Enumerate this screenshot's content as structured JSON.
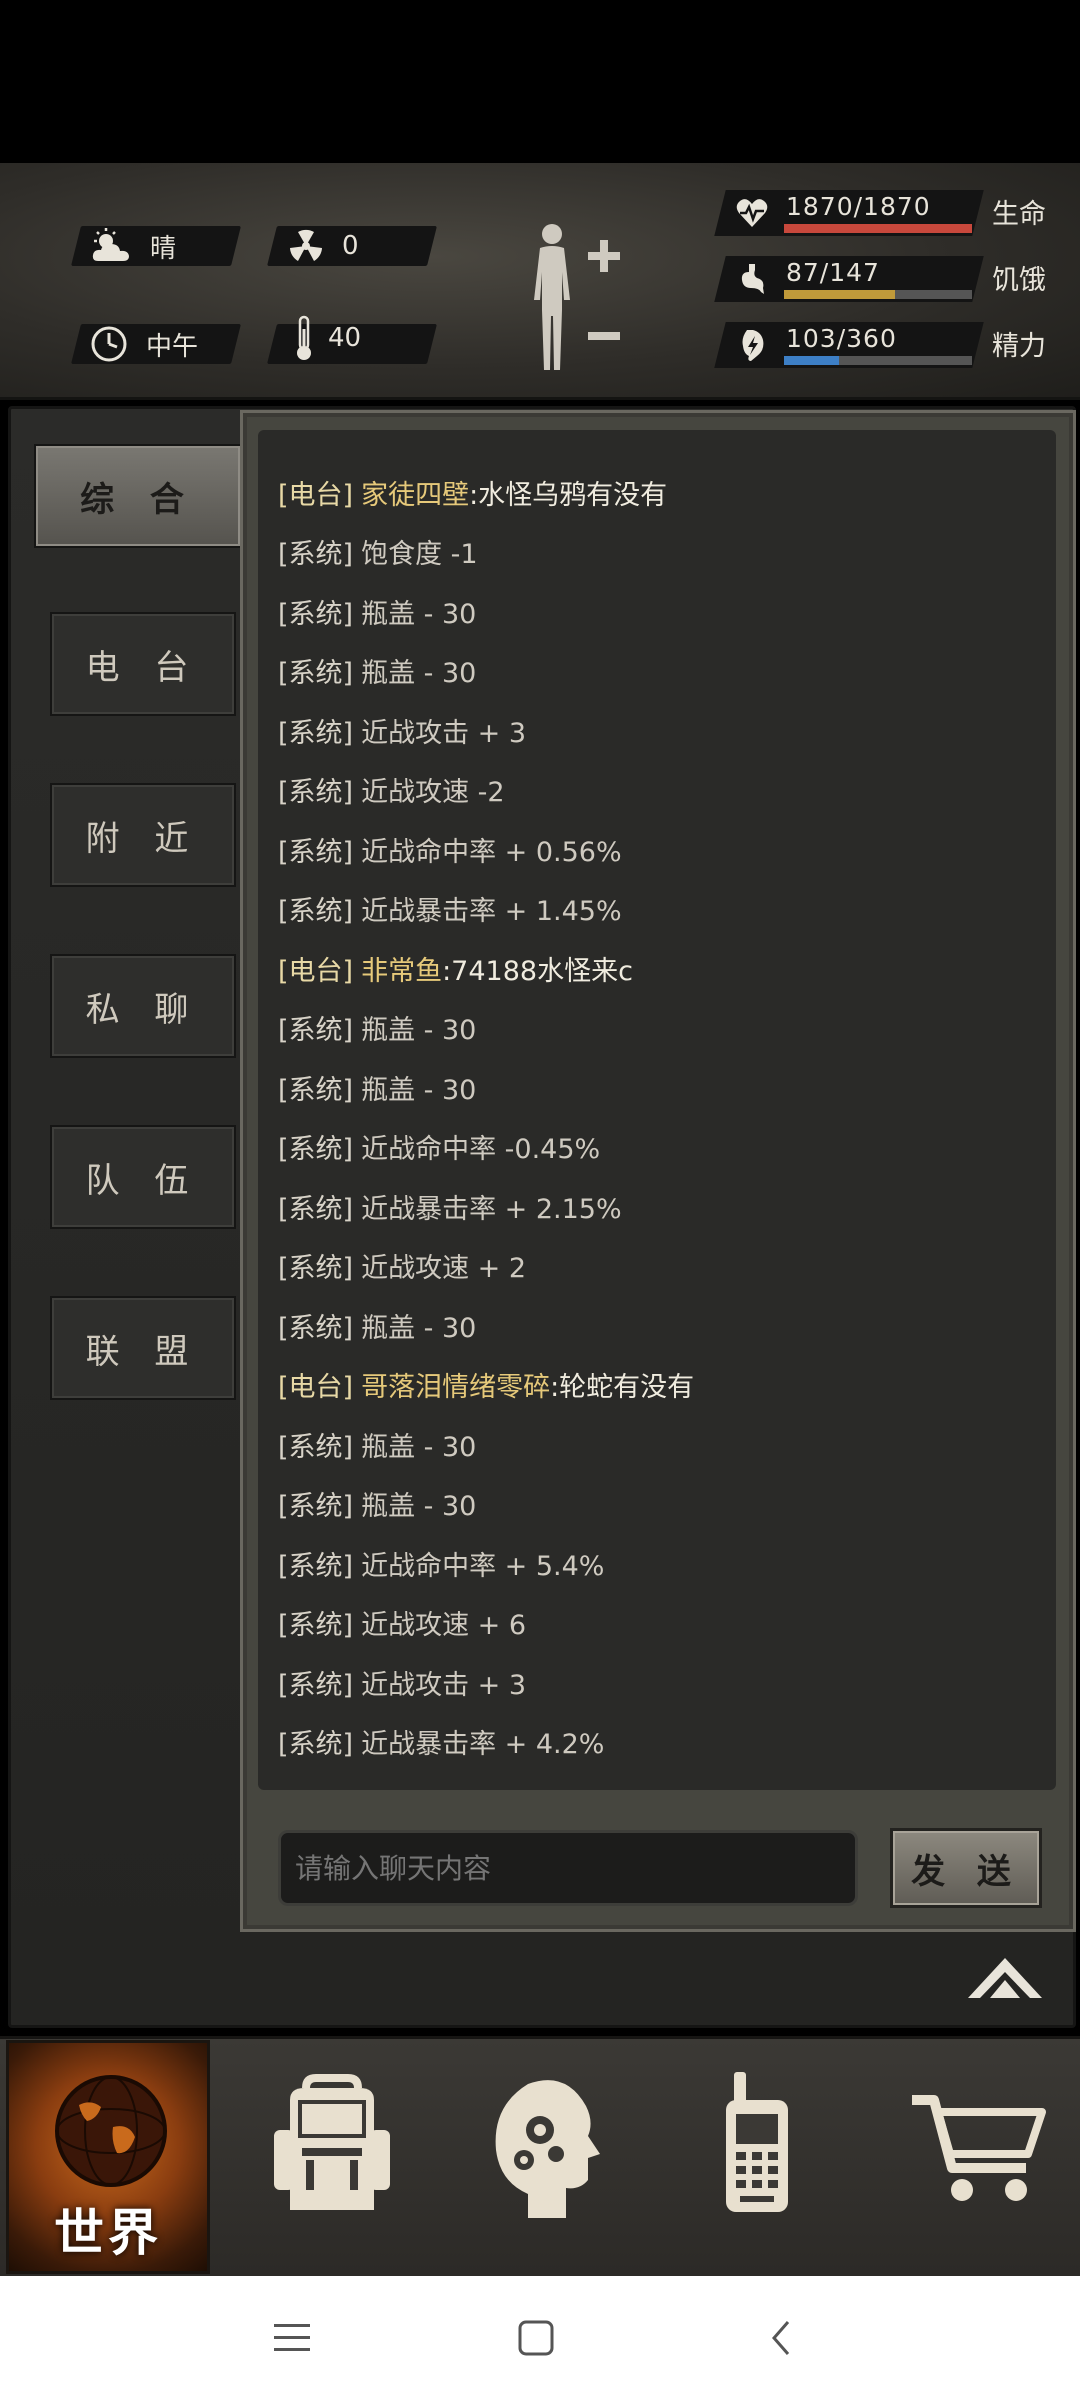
{
  "status": {
    "weather": "晴",
    "radiation": "0",
    "time": "中午",
    "temperature": "40"
  },
  "stats": [
    {
      "value": "1870/1870",
      "label": "生命",
      "fraction": 1.0,
      "color": "#c8483c"
    },
    {
      "value": "87/147",
      "label": "饥饿",
      "fraction": 0.59,
      "color": "#c09a3a"
    },
    {
      "value": "103/360",
      "label": "精力",
      "fraction": 0.29,
      "color": "#3d7fc6"
    }
  ],
  "tabs": [
    "综 合",
    "电 台",
    "附 近",
    "私 聊",
    "队 伍",
    "联 盟"
  ],
  "chat": [
    {
      "tag": "[电台]",
      "user": "家徒四壁",
      "msg": ":水怪乌鸦有没有",
      "type": "radio"
    },
    {
      "tag": "[系统]",
      "msg": "饱食度 -1",
      "type": "system"
    },
    {
      "tag": "[系统]",
      "msg": "瓶盖 - 30",
      "type": "system"
    },
    {
      "tag": "[系统]",
      "msg": "瓶盖 - 30",
      "type": "system"
    },
    {
      "tag": "[系统]",
      "msg": "近战攻击 + 3",
      "type": "system"
    },
    {
      "tag": "[系统]",
      "msg": "近战攻速 -2",
      "type": "system"
    },
    {
      "tag": "[系统]",
      "msg": "近战命中率 + 0.56%",
      "type": "system"
    },
    {
      "tag": "[系统]",
      "msg": "近战暴击率 + 1.45%",
      "type": "system"
    },
    {
      "tag": "[电台]",
      "user": "非常鱼",
      "msg": ":74188水怪来c",
      "type": "radio"
    },
    {
      "tag": "[系统]",
      "msg": "瓶盖 - 30",
      "type": "system"
    },
    {
      "tag": "[系统]",
      "msg": "瓶盖 - 30",
      "type": "system"
    },
    {
      "tag": "[系统]",
      "msg": "近战命中率 -0.45%",
      "type": "system"
    },
    {
      "tag": "[系统]",
      "msg": "近战暴击率 + 2.15%",
      "type": "system"
    },
    {
      "tag": "[系统]",
      "msg": "近战攻速 + 2",
      "type": "system"
    },
    {
      "tag": "[系统]",
      "msg": "瓶盖 - 30",
      "type": "system"
    },
    {
      "tag": "[电台]",
      "user": "哥落泪情绪零碎",
      "msg": ":轮蛇有没有",
      "type": "radio"
    },
    {
      "tag": "[系统]",
      "msg": "瓶盖 - 30",
      "type": "system"
    },
    {
      "tag": "[系统]",
      "msg": "瓶盖 - 30",
      "type": "system"
    },
    {
      "tag": "[系统]",
      "msg": "近战命中率 + 5.4%",
      "type": "system"
    },
    {
      "tag": "[系统]",
      "msg": "近战攻速 + 6",
      "type": "system"
    },
    {
      "tag": "[系统]",
      "msg": "近战攻击 + 3",
      "type": "system"
    },
    {
      "tag": "[系统]",
      "msg": "近战暴击率 + 4.2%",
      "type": "system"
    }
  ],
  "input": {
    "placeholder": "请输入聊天内容"
  },
  "send_label": "发 送",
  "bottom_nav": {
    "world_label": "世界"
  },
  "icons": [
    "sun-cloud-icon",
    "radiation-icon",
    "clock-icon",
    "thermometer-icon",
    "body-icon",
    "heart-icon",
    "stomach-icon",
    "energy-icon",
    "up-arrow-icon",
    "globe-icon",
    "backpack-icon",
    "head-gears-icon",
    "walkie-talkie-icon",
    "cart-icon"
  ]
}
